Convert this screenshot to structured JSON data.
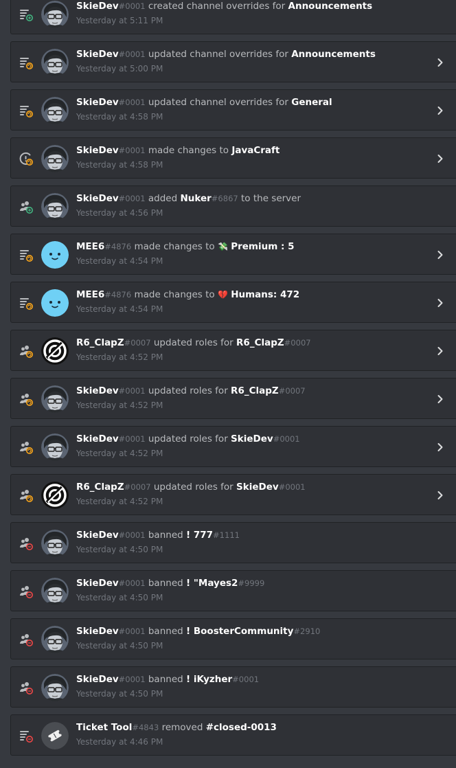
{
  "colors": {
    "background": "#36393f",
    "card": "#2f3136",
    "card_border": "#202225",
    "text_white": "#ffffff",
    "text_muted": "#b9bbbe",
    "text_dim": "#72767d",
    "create_green": "#43b581",
    "update_orange": "#faa61a",
    "delete_red": "#f04747"
  },
  "entries": [
    {
      "user": "SkieDev",
      "disc": "#0001",
      "avatar": "skiedev-avatar",
      "icon": "channel-overwrite-create-icon",
      "action": "created channel overrides for",
      "emoji": "",
      "target": "Announcements",
      "target_disc": "",
      "suffix": "",
      "time": "Yesterday at 5:11 PM",
      "expandable": false
    },
    {
      "user": "SkieDev",
      "disc": "#0001",
      "avatar": "skiedev-avatar",
      "icon": "channel-overwrite-update-icon",
      "action": "updated channel overrides for",
      "emoji": "",
      "target": "Announcements",
      "target_disc": "",
      "suffix": "",
      "time": "Yesterday at 5:00 PM",
      "expandable": true
    },
    {
      "user": "SkieDev",
      "disc": "#0001",
      "avatar": "skiedev-avatar",
      "icon": "channel-overwrite-update-icon",
      "action": "updated channel overrides for",
      "emoji": "",
      "target": "General",
      "target_disc": "",
      "suffix": "",
      "time": "Yesterday at 4:58 PM",
      "expandable": true
    },
    {
      "user": "SkieDev",
      "disc": "#0001",
      "avatar": "skiedev-avatar",
      "icon": "server-update-icon",
      "action": "made changes to",
      "emoji": "",
      "target": "JavaCraft",
      "target_disc": "",
      "suffix": "",
      "time": "Yesterday at 4:58 PM",
      "expandable": true
    },
    {
      "user": "SkieDev",
      "disc": "#0001",
      "avatar": "skiedev-avatar",
      "icon": "member-add-icon",
      "action": "added",
      "emoji": "",
      "target": "Nuker",
      "target_disc": "#6867",
      "suffix": "to the server",
      "time": "Yesterday at 4:56 PM",
      "expandable": false
    },
    {
      "user": "MEE6",
      "disc": "#4876",
      "avatar": "mee6-avatar",
      "icon": "channel-update-icon",
      "action": "made changes to",
      "emoji": "💸",
      "target": "Premium : 5",
      "target_disc": "",
      "suffix": "",
      "time": "Yesterday at 4:54 PM",
      "expandable": true
    },
    {
      "user": "MEE6",
      "disc": "#4876",
      "avatar": "mee6-avatar",
      "icon": "channel-update-icon",
      "action": "made changes to",
      "emoji": "💔",
      "target": "Humans: 472",
      "target_disc": "",
      "suffix": "",
      "time": "Yesterday at 4:54 PM",
      "expandable": true
    },
    {
      "user": "R6_ClapZ",
      "disc": "#0007",
      "avatar": "r6clapz-avatar",
      "icon": "member-role-update-icon",
      "action": "updated roles for",
      "emoji": "",
      "target": "R6_ClapZ",
      "target_disc": "#0007",
      "suffix": "",
      "time": "Yesterday at 4:52 PM",
      "expandable": true
    },
    {
      "user": "SkieDev",
      "disc": "#0001",
      "avatar": "skiedev-avatar",
      "icon": "member-role-update-icon",
      "action": "updated roles for",
      "emoji": "",
      "target": "R6_ClapZ",
      "target_disc": "#0007",
      "suffix": "",
      "time": "Yesterday at 4:52 PM",
      "expandable": true
    },
    {
      "user": "SkieDev",
      "disc": "#0001",
      "avatar": "skiedev-avatar",
      "icon": "member-role-update-icon",
      "action": "updated roles for",
      "emoji": "",
      "target": "SkieDev",
      "target_disc": "#0001",
      "suffix": "",
      "time": "Yesterday at 4:52 PM",
      "expandable": true
    },
    {
      "user": "R6_ClapZ",
      "disc": "#0007",
      "avatar": "r6clapz-avatar",
      "icon": "member-role-update-icon",
      "action": "updated roles for",
      "emoji": "",
      "target": "SkieDev",
      "target_disc": "#0001",
      "suffix": "",
      "time": "Yesterday at 4:52 PM",
      "expandable": true
    },
    {
      "user": "SkieDev",
      "disc": "#0001",
      "avatar": "skiedev-avatar",
      "icon": "member-ban-icon",
      "action": "banned",
      "emoji": "",
      "target": "! 777",
      "target_disc": "#1111",
      "suffix": "",
      "time": "Yesterday at 4:50 PM",
      "expandable": false
    },
    {
      "user": "SkieDev",
      "disc": "#0001",
      "avatar": "skiedev-avatar",
      "icon": "member-ban-icon",
      "action": "banned",
      "emoji": "",
      "target": "! \"Mayes2",
      "target_disc": "#9999",
      "suffix": "",
      "time": "Yesterday at 4:50 PM",
      "expandable": false
    },
    {
      "user": "SkieDev",
      "disc": "#0001",
      "avatar": "skiedev-avatar",
      "icon": "member-ban-icon",
      "action": "banned",
      "emoji": "",
      "target": "! BoosterCommunity",
      "target_disc": "#2910",
      "suffix": "",
      "time": "Yesterday at 4:50 PM",
      "expandable": false
    },
    {
      "user": "SkieDev",
      "disc": "#0001",
      "avatar": "skiedev-avatar",
      "icon": "member-ban-icon",
      "action": "banned",
      "emoji": "",
      "target": "! iKyzher",
      "target_disc": "#0001",
      "suffix": "",
      "time": "Yesterday at 4:50 PM",
      "expandable": false
    },
    {
      "user": "Ticket Tool",
      "disc": "#4843",
      "avatar": "ticket-tool-avatar",
      "icon": "channel-delete-icon",
      "action": "removed",
      "emoji": "",
      "target": "#closed-0013",
      "target_disc": "",
      "suffix": "",
      "time": "Yesterday at 4:46 PM",
      "expandable": false
    }
  ]
}
